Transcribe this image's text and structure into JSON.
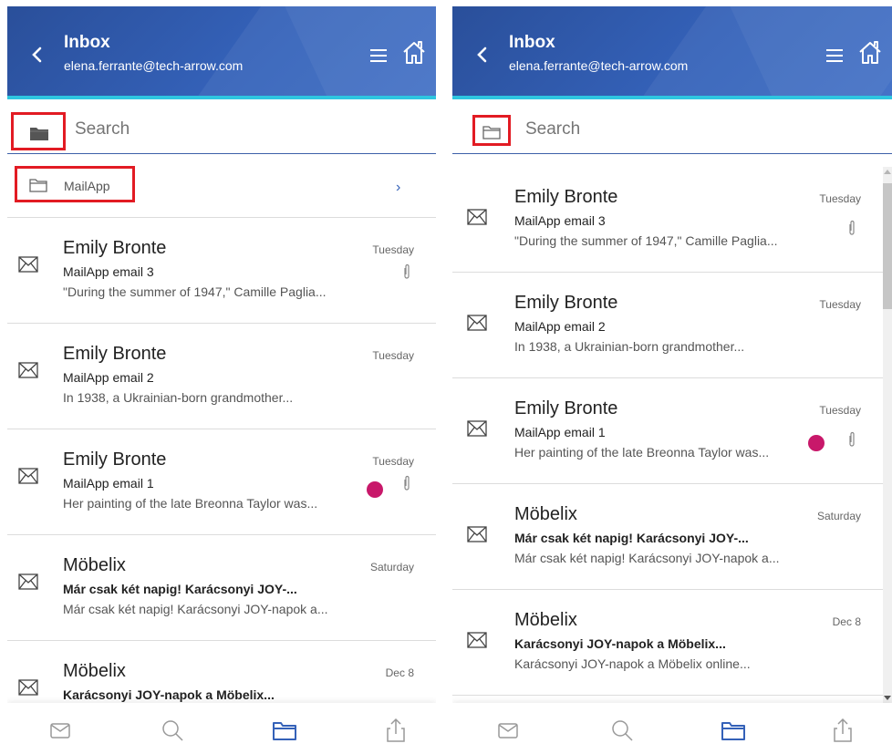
{
  "header": {
    "title": "Inbox",
    "account": "elena.ferrante@tech-arrow.com"
  },
  "search": {
    "placeholder": "Search"
  },
  "folder_row": {
    "label": "MailApp",
    "chevron": "›"
  },
  "emails_left": [
    {
      "sender": "Emily Bronte",
      "subject": "MailApp email 3",
      "preview": "\"During the summer of 1947,\" Camille Paglia...",
      "date": "Tuesday"
    },
    {
      "sender": "Emily Bronte",
      "subject": "MailApp email 2",
      "preview": "In 1938, a Ukrainian-born grandmother...",
      "date": "Tuesday"
    },
    {
      "sender": "Emily Bronte",
      "subject": "MailApp email 1",
      "preview": "Her painting of the late Breonna Taylor was...",
      "date": "Tuesday"
    },
    {
      "sender": "Möbelix",
      "subject": "Már csak két napig! Karácsonyi JOY-...",
      "preview": "Már csak két napig! Karácsonyi JOY-napok a...",
      "date": "Saturday"
    },
    {
      "sender": "Möbelix",
      "subject": "Karácsonyi JOY-napok a Möbelix...",
      "preview": "",
      "date": "Dec 8"
    }
  ],
  "emails_right": [
    {
      "sender": "Emily Bronte",
      "subject": "MailApp email 3",
      "preview": "\"During the summer of 1947,\" Camille Paglia...",
      "date": "Tuesday"
    },
    {
      "sender": "Emily Bronte",
      "subject": "MailApp email 2",
      "preview": "In 1938, a Ukrainian-born grandmother...",
      "date": "Tuesday"
    },
    {
      "sender": "Emily Bronte",
      "subject": "MailApp email 1",
      "preview": "Her painting of the late Breonna Taylor was...",
      "date": "Tuesday"
    },
    {
      "sender": "Möbelix",
      "subject": "Már csak két napig! Karácsonyi JOY-...",
      "preview": "Már csak két napig! Karácsonyi JOY-napok a...",
      "date": "Saturday"
    },
    {
      "sender": "Möbelix",
      "subject": "Karácsonyi JOY-napok a Möbelix...",
      "preview": "Karácsonyi JOY-napok a Möbelix online...",
      "date": "Dec 8"
    }
  ],
  "icons": {
    "back": "chevron-left-icon",
    "menu": "hamburger-menu-icon",
    "home": "home-icon",
    "folder_filled": "folder-filled-icon",
    "folder_outline": "folder-outline-icon",
    "envelope": "envelope-icon",
    "paperclip": "paperclip-icon",
    "nav_mail": "mail-icon",
    "nav_search": "search-icon",
    "nav_folder": "folder-icon",
    "nav_share": "share-icon"
  },
  "colors": {
    "header": "#3461b8",
    "accent_line": "#2ec6e0",
    "highlight_box": "#e21b23",
    "unread_dot": "#c8186a",
    "active_nav": "#3461b8"
  }
}
